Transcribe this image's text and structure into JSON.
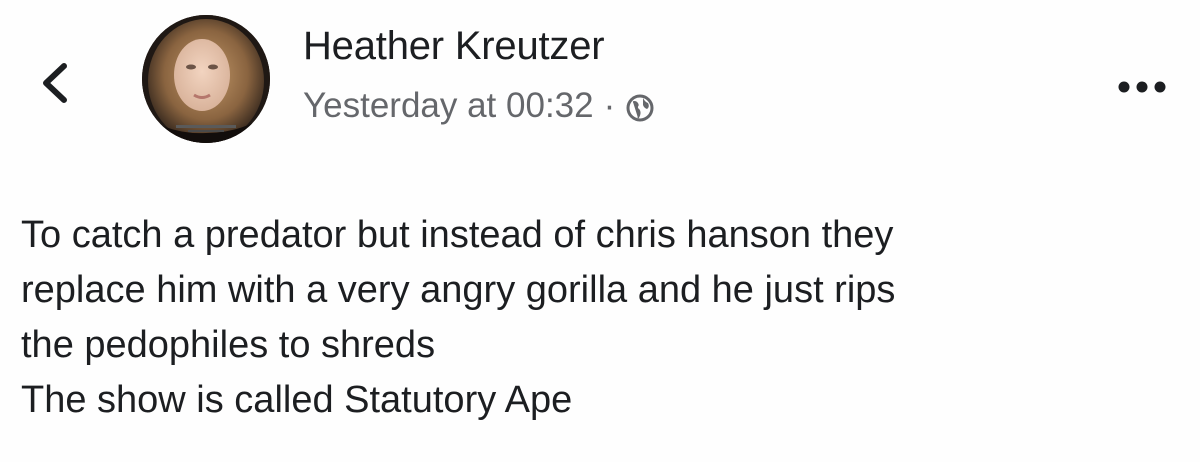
{
  "post": {
    "author_name": "Heather Kreutzer",
    "timestamp": "Yesterday at 00:32",
    "separator": "·",
    "audience_icon": "globe-icon",
    "back_icon": "chevron-left-icon",
    "more_icon": "ellipsis-icon",
    "body_lines": [
      "To catch a predator but instead of chris hanson they",
      "replace him with a very angry gorilla and he just rips",
      "the pedophiles to shreds",
      "The show is called Statutory Ape"
    ]
  },
  "colors": {
    "text_primary": "#1c1e21",
    "text_secondary": "#65676b",
    "background": "#fefefe"
  }
}
